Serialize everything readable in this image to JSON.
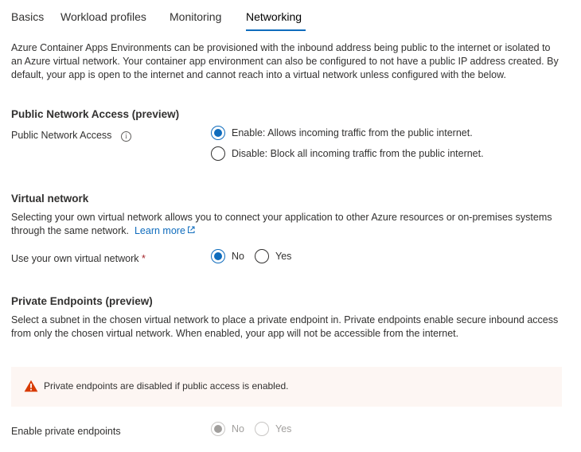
{
  "tabs": [
    {
      "label": "Basics"
    },
    {
      "label": "Workload profiles"
    },
    {
      "label": "Monitoring"
    },
    {
      "label": "Networking",
      "active": true
    }
  ],
  "intro_text": "Azure Container Apps Environments can be provisioned with the inbound address being public to the internet or isolated to an Azure virtual network. Your container app environment can also be configured to not have a public IP address created. By default, your app is open to the internet and cannot reach into a virtual network unless configured with the below.",
  "public_access": {
    "heading": "Public Network Access (preview)",
    "field_label": "Public Network Access",
    "options": [
      {
        "label": "Enable: Allows incoming traffic from the public internet.",
        "selected": true
      },
      {
        "label": "Disable: Block all incoming traffic from the public internet.",
        "selected": false
      }
    ]
  },
  "virtual_network": {
    "heading": "Virtual network",
    "description": "Selecting your own virtual network allows you to connect your application to other Azure resources or on-premises systems through the same network.",
    "learn_more": "Learn more",
    "field_label": "Use your own virtual network",
    "required_mark": "*",
    "options": [
      {
        "label": "No",
        "selected": true
      },
      {
        "label": "Yes",
        "selected": false
      }
    ]
  },
  "private_endpoints": {
    "heading": "Private Endpoints (preview)",
    "description": "Select a subnet in the chosen virtual network to place a private endpoint in. Private endpoints enable secure inbound access from only the chosen virtual network. When enabled, your app will not be accessible from the internet.",
    "warning": "Private endpoints are disabled if public access is enabled.",
    "field_label": "Enable private endpoints",
    "options": [
      {
        "label": "No",
        "selected": true,
        "disabled": true
      },
      {
        "label": "Yes",
        "selected": false,
        "disabled": true
      }
    ]
  },
  "colors": {
    "accent": "#0f6cbd",
    "warning_icon": "#d83b01",
    "warning_bg": "#fdf6f3",
    "required": "#a4262c"
  }
}
